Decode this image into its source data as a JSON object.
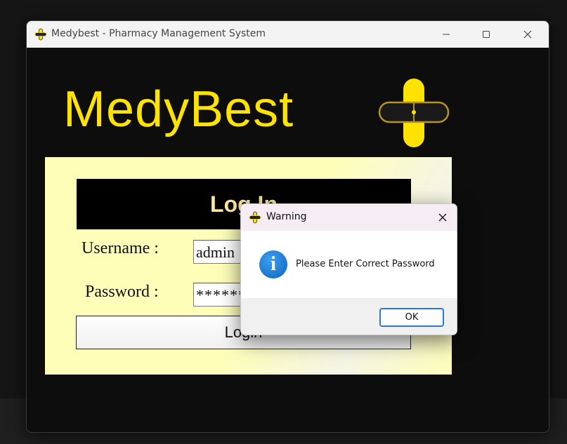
{
  "window": {
    "title": "Medybest - Pharmacy Management System"
  },
  "brand": {
    "name": "MedyBest",
    "accent_color": "#ffe300"
  },
  "login": {
    "header": "Log In",
    "username_label": "Username :",
    "username_value": "admin",
    "password_label": "Password :",
    "password_value": "********",
    "button_label": "Login"
  },
  "dialog": {
    "title": "Warning",
    "message": "Please Enter Correct Password",
    "ok_label": "OK",
    "icon": "info-icon"
  }
}
